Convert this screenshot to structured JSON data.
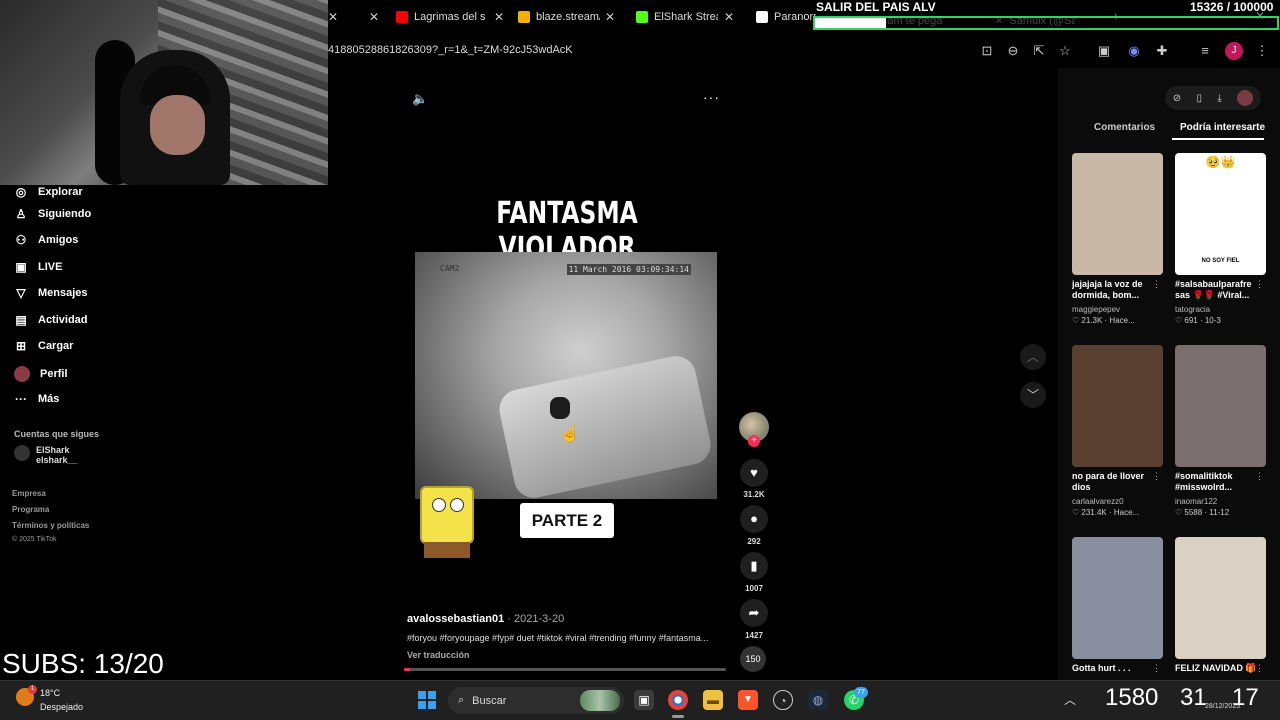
{
  "browser": {
    "tabs": [
      {
        "label": "Lagrimas del s",
        "color": "#ff0000"
      },
      {
        "label": "blaze.stream/e",
        "color": "#f5b000"
      },
      {
        "label": "ElShark Stream",
        "color": "#53fc18"
      },
      {
        "label": "Paranorm",
        "color": "#ffffff"
      },
      {
        "label": "Sam te pega",
        "color": "#888888"
      },
      {
        "label": "Samuix (@Sa",
        "color": "#888888"
      }
    ],
    "url": "41880528861826309?_r=1&_t=ZM-92cJ53wdAcK",
    "profile_initial": "J"
  },
  "stream_overlay": {
    "goal_title": "SALIR DEL PAIS ALV",
    "goal_count": "15326 / 100000",
    "goal_progress": 0.153,
    "subs_text": "SUBS: 13/20"
  },
  "leftnav": {
    "items": [
      {
        "icon": "compass-icon",
        "glyph": "◎",
        "label": "Explorar"
      },
      {
        "icon": "following-icon",
        "glyph": "♙",
        "label": "Siguiendo"
      },
      {
        "icon": "friends-icon",
        "glyph": "⚇",
        "label": "Amigos"
      },
      {
        "icon": "live-icon",
        "glyph": "▣",
        "label": "LIVE"
      },
      {
        "icon": "messages-icon",
        "glyph": "▽",
        "label": "Mensajes"
      },
      {
        "icon": "activity-icon",
        "glyph": "▤",
        "label": "Actividad"
      },
      {
        "icon": "upload-icon",
        "glyph": "⊞",
        "label": "Cargar"
      },
      {
        "icon": "profile-avatar",
        "glyph": "",
        "label": "Perfil"
      },
      {
        "icon": "more-icon",
        "glyph": "···",
        "label": "Más"
      }
    ],
    "following_title": "Cuentas que sigues",
    "following": [
      {
        "name": "ElShark",
        "handle": "elshark__"
      }
    ],
    "footer": [
      "Empresa",
      "Programa",
      "Términos y políticas"
    ],
    "copyright": "© 2025 TikTok"
  },
  "video": {
    "title": "FANTASMA VIOLADOR",
    "cam_label": "CAM2",
    "cam_date": "11 March 2016 03:09:34:14",
    "sticker_text": "PARTE 2",
    "author": "avalossebastian01",
    "date": "2021-3-20",
    "caption": "#foryou #foryoupage #fyp# duet #tiktok #viral #trending #funny #fantasma...",
    "translate": "Ver traducción",
    "progress": 0.02,
    "likes": "31.2K",
    "comments": "292",
    "saves": "1007",
    "shares": "1427",
    "music_overlay": "150"
  },
  "right_panel": {
    "tabs": [
      "Comentarios",
      "Podría interesarte"
    ],
    "cards": [
      {
        "title": "jajajaja la voz de dormida, bom...",
        "author": "maggiepepev",
        "stats": "♡ 21.3K · Hace...",
        "bg": "#c9b8a8"
      },
      {
        "title": "#salsabaulparafre sas 🌹🌹 #Viral...",
        "author": "tatogracia",
        "stats": "♡ 691 · 10-3",
        "bg": "#ffffff",
        "emoji": "🥹👑",
        "caption_top": "NO SOY FIEL"
      },
      {
        "title": "no para de llover dios",
        "author": "carlaalvarezz0",
        "stats": "♡ 231.4K · Hace...",
        "bg": "#5a4030"
      },
      {
        "title": "#somalitiktok #misswolrd...",
        "author": "inaomar122",
        "stats": "♡ 5588 · 11-12",
        "bg": "#7a6e6e"
      },
      {
        "title": "Gotta hurt . . .",
        "author": "",
        "stats": "",
        "bg": "#8a8fa0"
      },
      {
        "title": "FELIZ NAVIDAD 🎁",
        "author": "",
        "stats": "",
        "bg": "#d9d2c4"
      }
    ]
  },
  "taskbar": {
    "weather_temp": "18°C",
    "weather_desc": "Despejado",
    "search_placeholder": "Buscar",
    "overlay_time_a": "1580",
    "overlay_time_b": "31",
    "overlay_time_c": "17",
    "date": "28/12/2025",
    "whatsapp_badge": "77"
  }
}
